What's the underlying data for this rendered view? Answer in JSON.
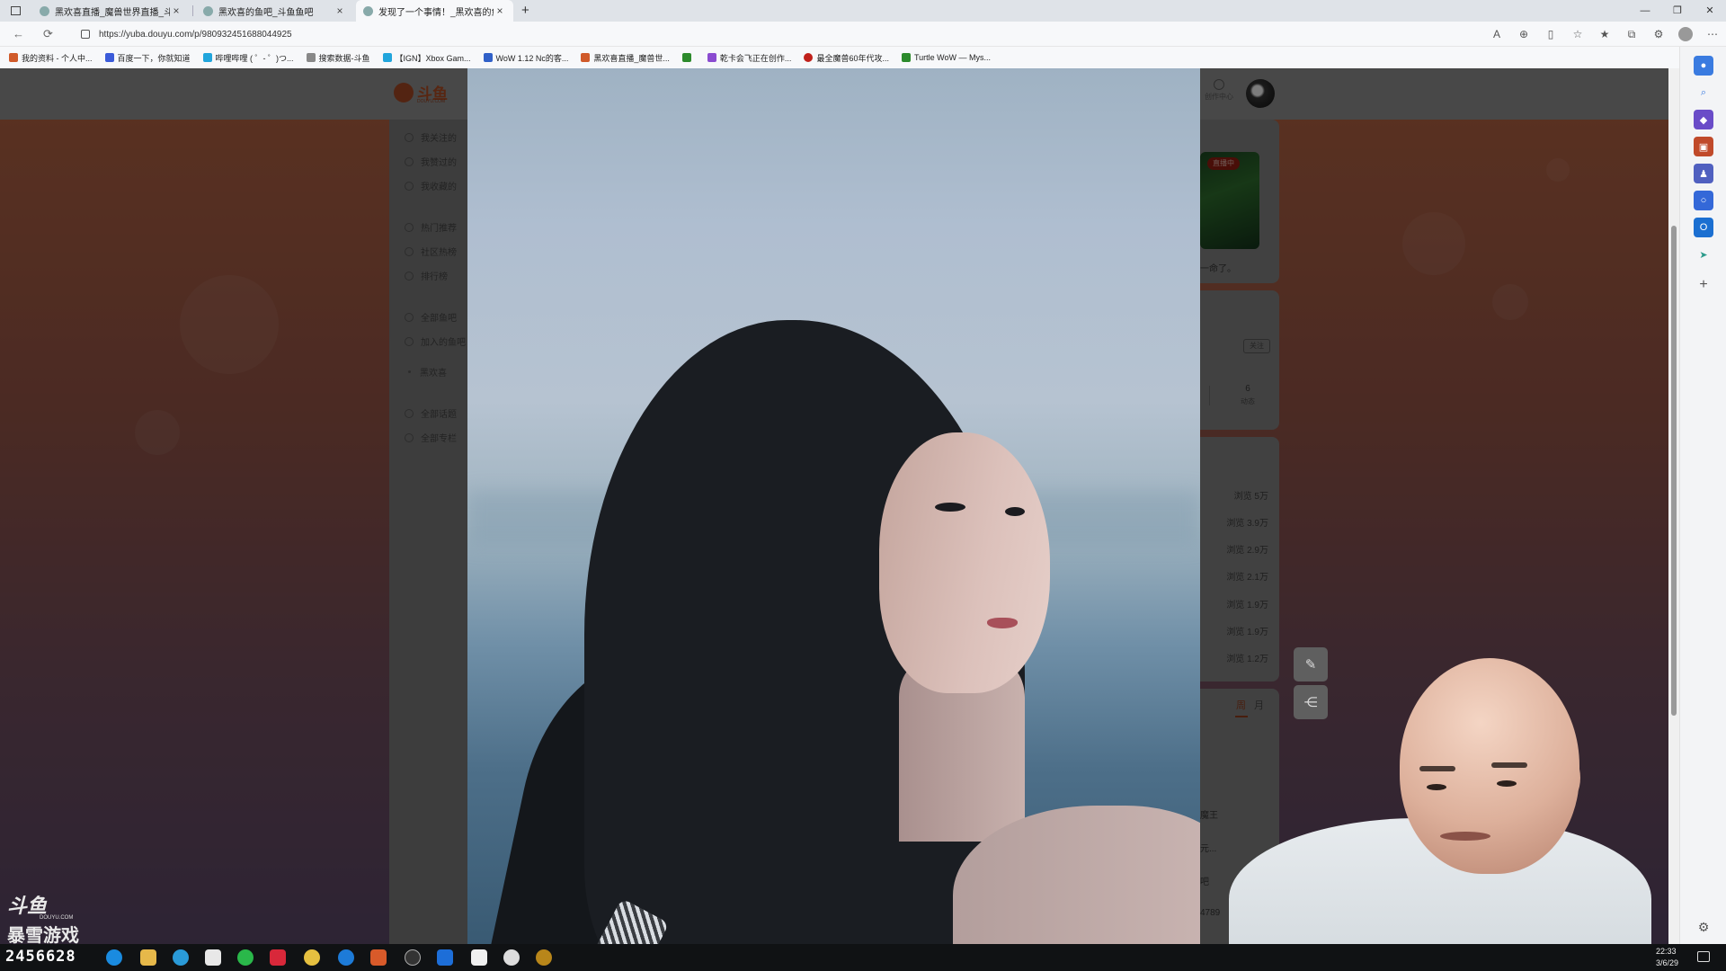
{
  "browser": {
    "tabs": [
      {
        "title": "黑欢喜直播_魔兽世界直播_斗鱼直",
        "active": false
      },
      {
        "title": "黑欢喜的鱼吧_斗鱼鱼吧",
        "active": false
      },
      {
        "title": "发现了一个事情！_黑欢喜的鱼吧",
        "active": true
      }
    ],
    "new_tab": "+",
    "url": "https://yuba.douyu.com/p/980932451688044925",
    "bookmarks": [
      {
        "label": "我的资料 - 个人中...",
        "color": "#d05a2a"
      },
      {
        "label": "百度一下，你就知道",
        "color": "#3b5bd9"
      },
      {
        "label": "哔哩哔哩 ( ゜- ゜)つ...",
        "color": "#21a5dc"
      },
      {
        "label": "搜索数据-斗鱼",
        "color": "#888888"
      },
      {
        "label": "【IGN】Xbox Gam...",
        "color": "#21a5dc"
      },
      {
        "label": "WoW 1.12 Nc的客...",
        "color": "#3060c8"
      },
      {
        "label": "黑欢喜直播_魔兽世...",
        "color": "#d05a2a"
      },
      {
        "label": "",
        "color": "#2c8a2c"
      },
      {
        "label": "乾卡会飞正在创作...",
        "color": "#8a4bd0"
      },
      {
        "label": "最全魔兽60年代攻...",
        "color": "#c0201a"
      },
      {
        "label": "Turtle WoW — Mys...",
        "color": "#2c8a2c"
      }
    ]
  },
  "site": {
    "logo_text": "斗鱼",
    "logo_sub": "DOUYU.COM",
    "creator_center": "创作中心"
  },
  "left_nav": {
    "items": [
      {
        "label": "我关注的",
        "icon": "star-icon"
      },
      {
        "label": "我赞过的",
        "icon": "thumb-up-icon"
      },
      {
        "label": "我收藏的",
        "icon": "bookmark-icon"
      },
      {
        "label": "热门推荐",
        "icon": "fire-icon"
      },
      {
        "label": "社区热榜",
        "icon": "chart-icon"
      },
      {
        "label": "排行榜",
        "icon": "trophy-icon"
      },
      {
        "label": "全部鱼吧",
        "icon": "home-icon"
      },
      {
        "label": "加入的鱼吧",
        "icon": "list-icon"
      },
      {
        "label": "黑欢喜",
        "icon": "dot-icon"
      },
      {
        "label": "全部话题",
        "icon": "topic-icon"
      },
      {
        "label": "全部专栏",
        "icon": "column-icon"
      }
    ]
  },
  "right_panel": {
    "live_badge": "直播中",
    "card_text": "一命了。",
    "follow": "关注",
    "stat_count": "6",
    "stat_label": "动态",
    "views": [
      "浏览 5万",
      "浏览 3.9万",
      "浏览 2.9万",
      "浏览 2.1万",
      "浏览 1.9万",
      "浏览 1.9万",
      "浏览 1.2万"
    ],
    "tab_week": "周",
    "tab_month": "月",
    "rank_items": [
      "魔王",
      "元...",
      "吧",
      "4789"
    ]
  },
  "stream": {
    "logo_top": "斗鱼",
    "logo_sub": "DOUYU.COM",
    "logo_bottom": "暴雪游戏",
    "room_id": "2456628"
  },
  "taskbar": {
    "time": "22:33",
    "date": "3/6/29"
  }
}
